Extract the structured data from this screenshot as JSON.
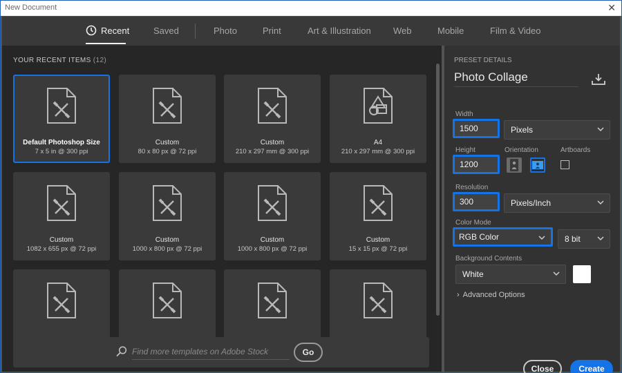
{
  "window": {
    "title": "New Document",
    "close_glyph": "✕"
  },
  "tabs": [
    {
      "label": "Recent",
      "icon": "clock-icon",
      "active": true
    },
    {
      "label": "Saved"
    },
    {
      "label": "Photo"
    },
    {
      "label": "Print"
    },
    {
      "label": "Art & Illustration"
    },
    {
      "label": "Web"
    },
    {
      "label": "Mobile"
    },
    {
      "label": "Film & Video"
    }
  ],
  "recent": {
    "heading": "YOUR RECENT ITEMS",
    "count": "(12)",
    "items": [
      {
        "name": "Default Photoshop Size",
        "dims": "7 x 5 in @ 300 ppi",
        "icon": "document-brush-icon",
        "selected": true
      },
      {
        "name": "Custom",
        "dims": "80 x 80 px @ 72 ppi",
        "icon": "document-brush-icon"
      },
      {
        "name": "Custom",
        "dims": "210 x 297 mm @ 300 ppi",
        "icon": "document-brush-icon"
      },
      {
        "name": "A4",
        "dims": "210 x 297 mm @ 300 ppi",
        "icon": "document-shapes-icon"
      },
      {
        "name": "Custom",
        "dims": "1082 x 655 px @ 72 ppi",
        "icon": "document-brush-icon"
      },
      {
        "name": "Custom",
        "dims": "1000 x 800 px @ 72 ppi",
        "icon": "document-brush-icon"
      },
      {
        "name": "Custom",
        "dims": "1000 x 800 px @ 72 ppi",
        "icon": "document-brush-icon"
      },
      {
        "name": "Custom",
        "dims": "15 x 15 px @ 72 ppi",
        "icon": "document-brush-icon"
      },
      {
        "name": "",
        "dims": "",
        "icon": "document-brush-icon"
      },
      {
        "name": "",
        "dims": "",
        "icon": "document-brush-icon"
      },
      {
        "name": "",
        "dims": "",
        "icon": "document-brush-icon"
      },
      {
        "name": "",
        "dims": "",
        "icon": "document-brush-icon"
      }
    ]
  },
  "search": {
    "placeholder": "Find more templates on Adobe Stock",
    "go_label": "Go"
  },
  "preset": {
    "section_label": "PRESET DETAILS",
    "name": "Photo Collage",
    "width_label": "Width",
    "width_value": "1500",
    "width_unit": "Pixels",
    "height_label": "Height",
    "height_value": "1200",
    "orientation_label": "Orientation",
    "artboards_label": "Artboards",
    "resolution_label": "Resolution",
    "resolution_value": "300",
    "resolution_unit": "Pixels/Inch",
    "color_mode_label": "Color Mode",
    "color_mode": "RGB Color",
    "bit_depth": "8 bit",
    "background_label": "Background Contents",
    "background": "White",
    "background_color": "#ffffff",
    "advanced_label": "Advanced Options",
    "advanced_arrow": "›"
  },
  "actions": {
    "close_label": "Close",
    "create_label": "Create"
  },
  "colors": {
    "accent": "#1473e6",
    "panel": "#262626",
    "card": "#3a3a3a"
  }
}
